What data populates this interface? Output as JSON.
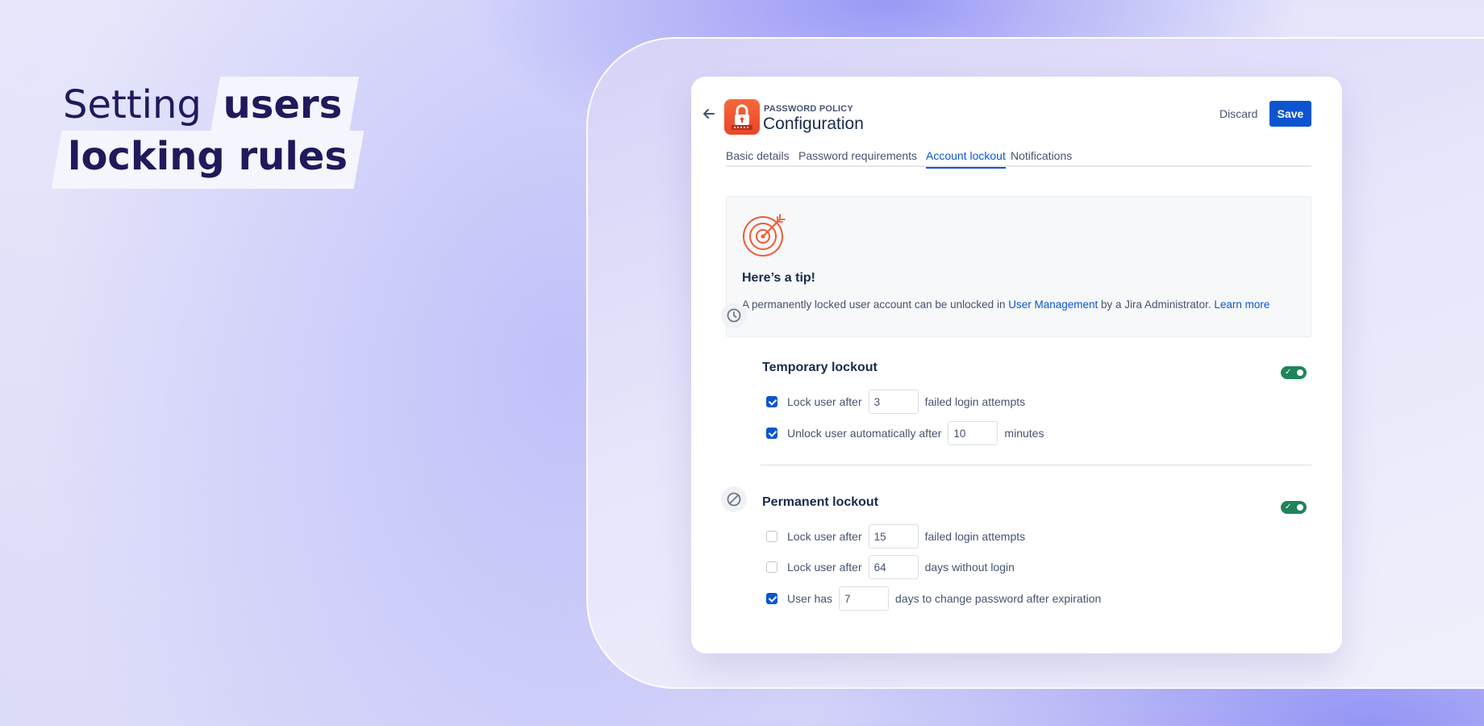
{
  "headline": {
    "line1_light": "Setting",
    "line1_bold": "users",
    "line2_bold": "locking rules"
  },
  "app": {
    "category": "PASSWORD POLICY",
    "title": "Configuration",
    "discard_label": "Discard",
    "save_label": "Save",
    "accent_color": "#0c55cf",
    "logo_color": "#e8452a"
  },
  "tabs": [
    {
      "label": "Basic details",
      "active": false
    },
    {
      "label": "Password requirements",
      "active": false
    },
    {
      "label": "Account lockout",
      "active": true
    },
    {
      "label": "Notifications",
      "active": false
    }
  ],
  "tip": {
    "title": "Here’s a tip!",
    "text_before": "A permanently locked user account can be unlocked in ",
    "link1": "User Management",
    "text_middle": " by a Jira Administrator. ",
    "link2": "Learn more",
    "icon": "target-icon"
  },
  "temporary": {
    "title": "Temporary lockout",
    "enabled": true,
    "rows": [
      {
        "checked": true,
        "before": "Lock user after",
        "value": "3",
        "after": "failed login attempts"
      },
      {
        "checked": true,
        "before": "Unlock user automatically after",
        "value": "10",
        "after": "minutes"
      }
    ]
  },
  "permanent": {
    "title": "Permanent lockout",
    "enabled": true,
    "rows": [
      {
        "checked": false,
        "before": "Lock user after",
        "value": "15",
        "after": "failed login attempts"
      },
      {
        "checked": false,
        "before": "Lock user after",
        "value": "64",
        "after": "days without login"
      },
      {
        "checked": true,
        "before": "User has",
        "value": "7",
        "after": "days to change password after expiration"
      }
    ]
  },
  "toggle_color": "#1f845a"
}
